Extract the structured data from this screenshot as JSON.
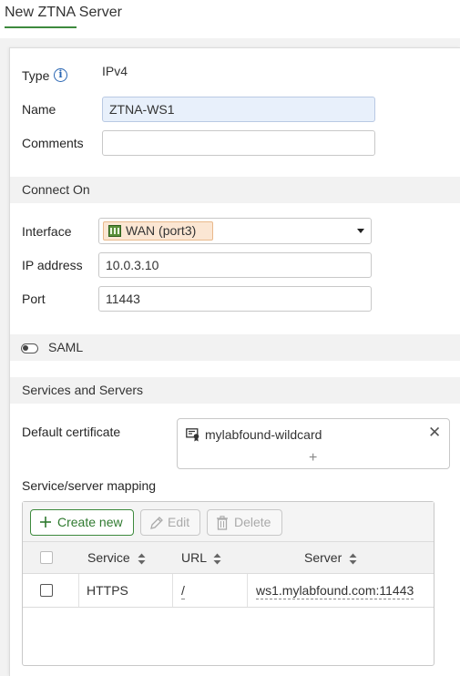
{
  "page": {
    "title": "New ZTNA Server"
  },
  "form": {
    "type_label": "Type",
    "type_value": "IPv4",
    "name_label": "Name",
    "name_value": "ZTNA-WS1",
    "comments_label": "Comments",
    "comments_value": ""
  },
  "connect_on": {
    "section_title": "Connect On",
    "interface_label": "Interface",
    "interface_value": "WAN (port3)",
    "ip_label": "IP address",
    "ip_value": "10.0.3.10",
    "port_label": "Port",
    "port_value": "11443"
  },
  "saml": {
    "label": "SAML",
    "enabled": false
  },
  "services": {
    "section_title": "Services and Servers",
    "cert_label": "Default certificate",
    "cert_value": "mylabfound-wildcard",
    "mapping_label": "Service/server mapping",
    "toolbar": {
      "create_label": "Create new",
      "edit_label": "Edit",
      "delete_label": "Delete"
    },
    "columns": {
      "service": "Service",
      "url": "URL",
      "server": "Server"
    },
    "rows": [
      {
        "service": "HTTPS",
        "url": "/",
        "server": "ws1.mylabfound.com:11443"
      }
    ]
  },
  "icons": {
    "info": "info-icon",
    "interface": "network-port-icon",
    "certificate": "certificate-icon",
    "remove": "close-icon",
    "add": "plus-icon",
    "create": "plus-icon",
    "edit": "pencil-icon",
    "delete": "trash-icon",
    "sort": "sort-icon"
  },
  "colors": {
    "accent": "#3d8a3d",
    "focus_bg": "#e8f0fb",
    "chip_bg": "#fbe6d3",
    "link": "#2a66b3"
  }
}
